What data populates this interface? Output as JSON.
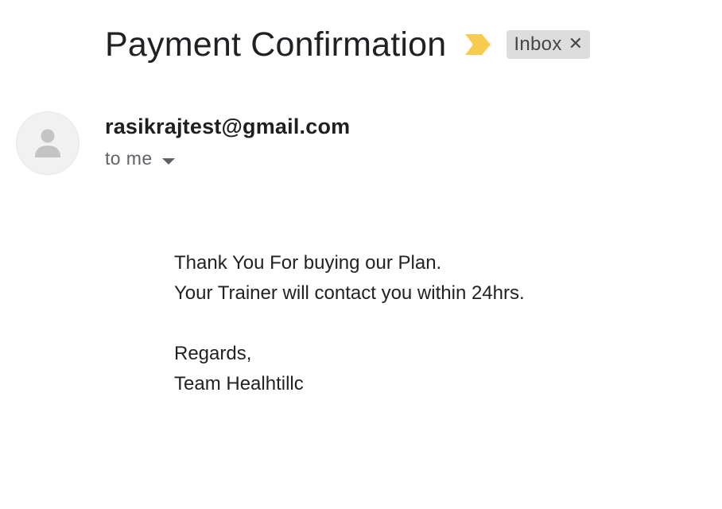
{
  "email": {
    "subject": "Payment Confirmation",
    "label": "Inbox",
    "label_close_glyph": "✕",
    "importance_icon": "importance-marker-icon",
    "importance_color": "#f7cb4d",
    "sender": "rasikrajtest@gmail.com",
    "recipient": "to me",
    "avatar_icon": "person-icon",
    "body": {
      "line1": "Thank You For buying our Plan.",
      "line2": "Your Trainer will contact you within 24hrs.",
      "line3": "Regards,",
      "line4": "Team Healhtillc"
    }
  }
}
